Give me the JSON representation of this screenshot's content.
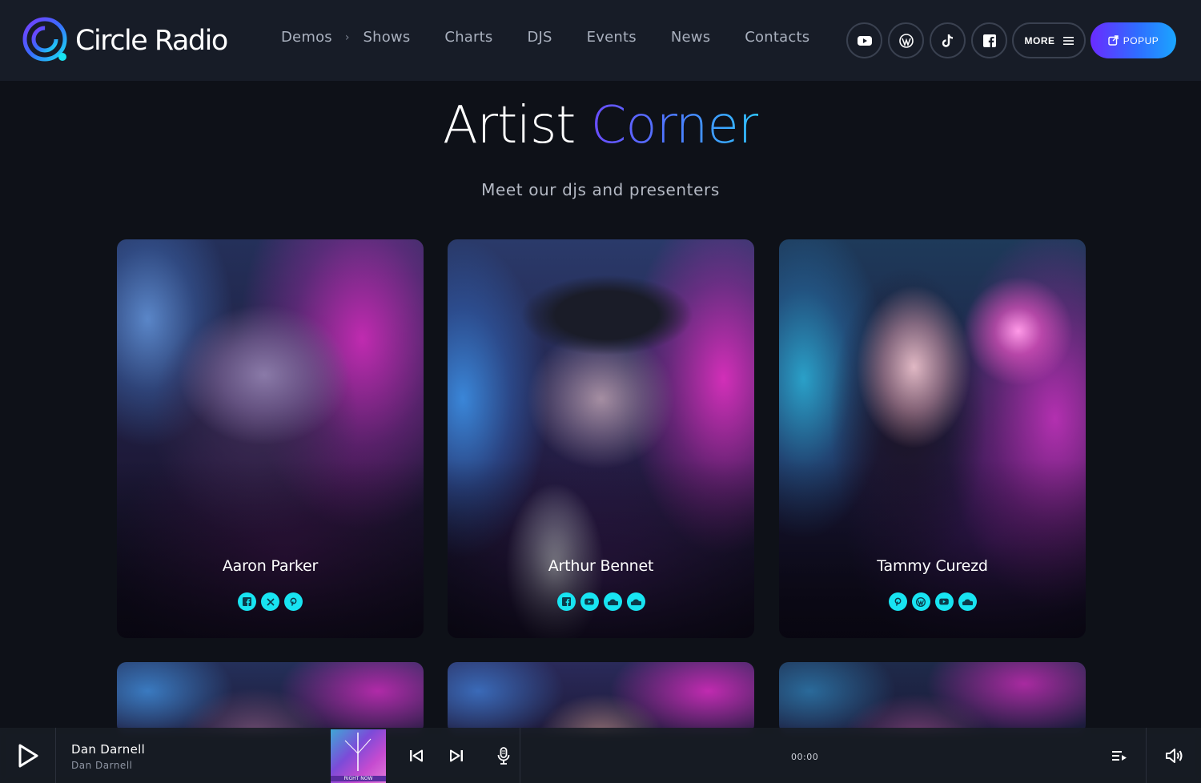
{
  "brand": {
    "name": "Circle Radio"
  },
  "nav": {
    "items": [
      "Demos",
      "Shows",
      "Charts",
      "DJS",
      "Events",
      "News",
      "Contacts"
    ]
  },
  "header_social": [
    "youtube-icon",
    "wordpress-icon",
    "tiktok-icon",
    "facebook-icon"
  ],
  "more": {
    "label": "MORE"
  },
  "popup": {
    "label": "POPUP"
  },
  "hero": {
    "title_part1": "Artist",
    "title_part2": "Corner",
    "subtitle": "Meet our djs and presenters"
  },
  "artists": [
    {
      "name": "Aaron Parker",
      "socials": [
        "facebook-icon",
        "x-icon",
        "pinterest-icon"
      ]
    },
    {
      "name": "Arthur Bennet",
      "socials": [
        "facebook-icon",
        "youtube-icon",
        "soundcloud-icon",
        "soundcloud-icon"
      ]
    },
    {
      "name": "Tammy Curezd",
      "socials": [
        "pinterest-icon",
        "wordpress-icon",
        "youtube-icon",
        "soundcloud-icon"
      ]
    }
  ],
  "player": {
    "track_title": "Dan Darnell",
    "track_artist": "Dan Darnell",
    "cover_text": "RIGHT NOW",
    "time": "00:00"
  },
  "colors": {
    "accent_cyan": "#18e4f2",
    "accent_purple": "#6a2bff",
    "accent_blue": "#2f6dff",
    "background": "#0e1118",
    "header": "#171c27"
  }
}
